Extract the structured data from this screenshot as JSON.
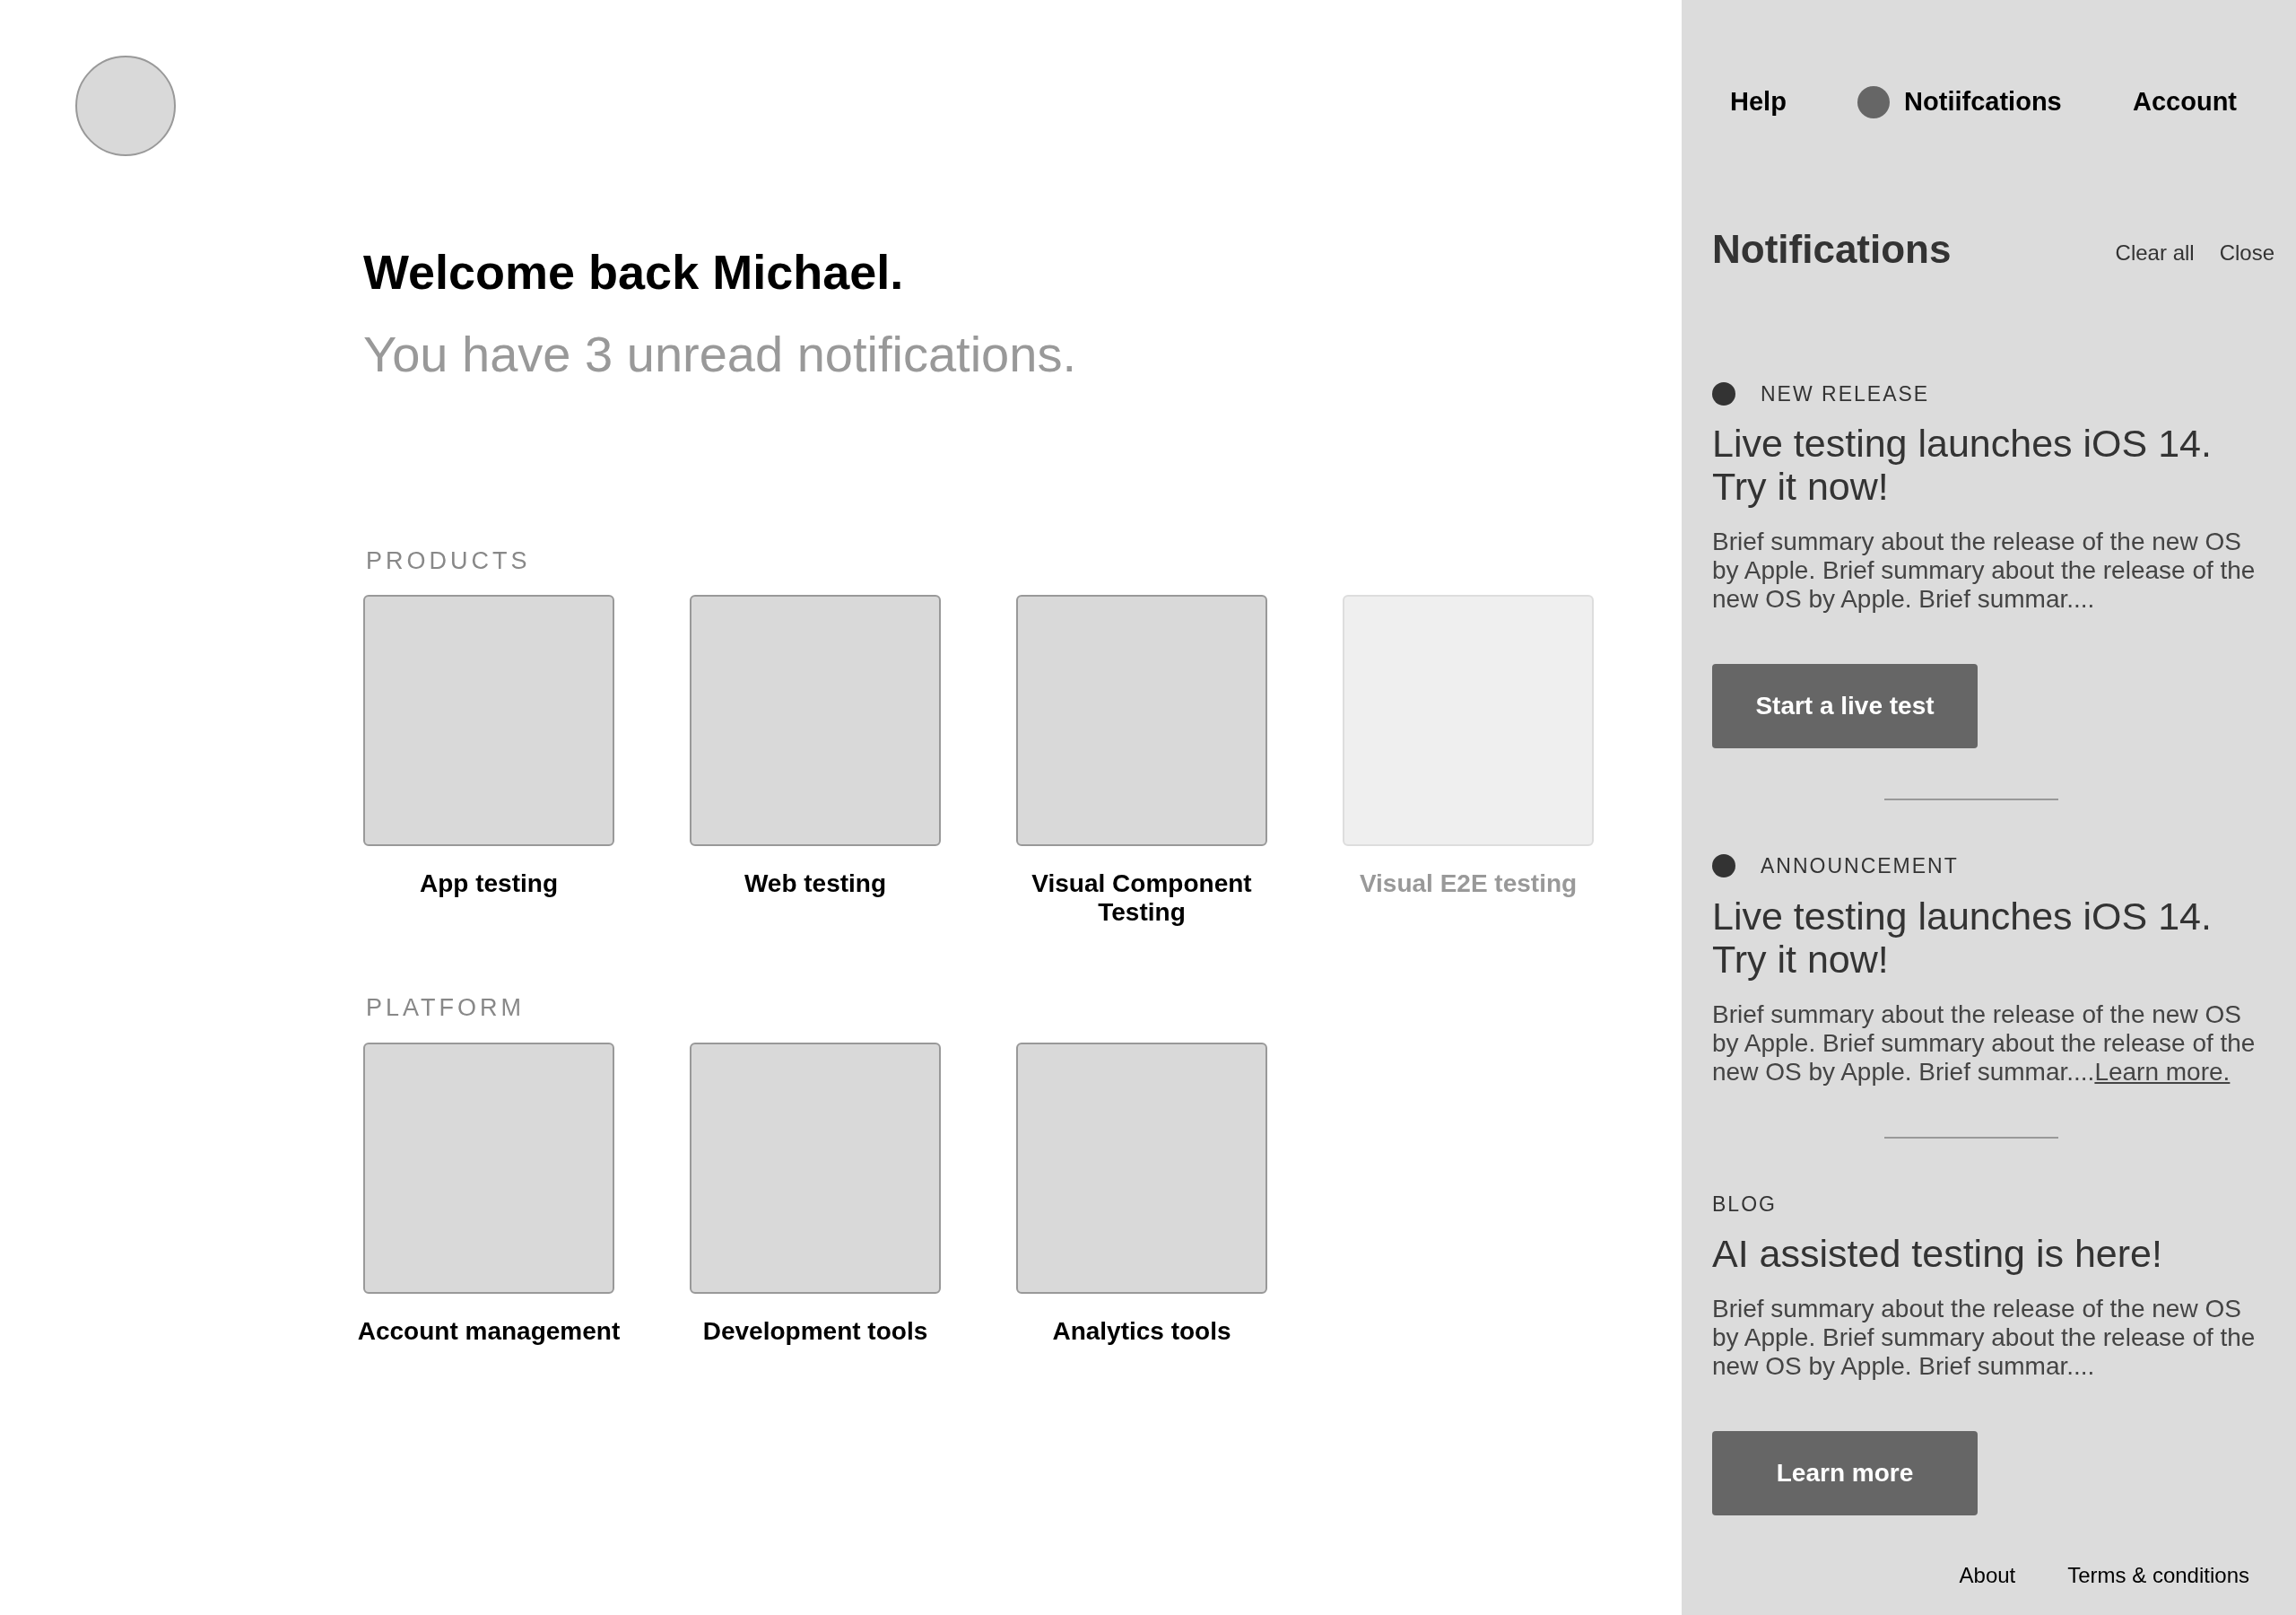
{
  "welcome": {
    "title": "Welcome back Michael.",
    "subtitle": "You have 3 unread notifications."
  },
  "sections": [
    {
      "label": "PRODUCTS",
      "tiles": [
        {
          "label": "App testing",
          "disabled": false
        },
        {
          "label": "Web testing",
          "disabled": false
        },
        {
          "label": "Visual Component Testing",
          "disabled": false
        },
        {
          "label": "Visual E2E testing",
          "disabled": true
        }
      ]
    },
    {
      "label": "PLATFORM",
      "tiles": [
        {
          "label": "Account management",
          "disabled": false
        },
        {
          "label": "Development tools",
          "disabled": false
        },
        {
          "label": "Analytics tools",
          "disabled": false
        }
      ]
    }
  ],
  "nav": [
    {
      "label": "Help",
      "indicator": false
    },
    {
      "label": "Notiifcations",
      "indicator": true
    },
    {
      "label": "Account",
      "indicator": false
    }
  ],
  "panel": {
    "title": "Notifications",
    "actions": [
      "Clear all",
      "Close"
    ]
  },
  "notifications": [
    {
      "category": "NEW RELEASE",
      "unread": true,
      "title": "Live testing launches iOS 14. Try it now!",
      "body": "Brief summary about the release of the new OS by Apple. Brief summary about the release of the new OS by Apple. Brief summar....",
      "button": "Start a live test"
    },
    {
      "category": "ANNOUNCEMENT",
      "unread": true,
      "title": "Live testing launches iOS 14. Try it now!",
      "body": "Brief summary about the release of the new OS by Apple. Brief summary about the release of the new OS by Apple. Brief summar....",
      "link": "Learn more."
    },
    {
      "category": "BLOG",
      "unread": false,
      "title": "AI assisted testing is here!",
      "body": "Brief summary about the release of the new OS by Apple. Brief summary about the release of the new OS by Apple. Brief summar....",
      "button": "Learn more"
    }
  ],
  "footer": [
    "About",
    "Terms & conditions"
  ]
}
